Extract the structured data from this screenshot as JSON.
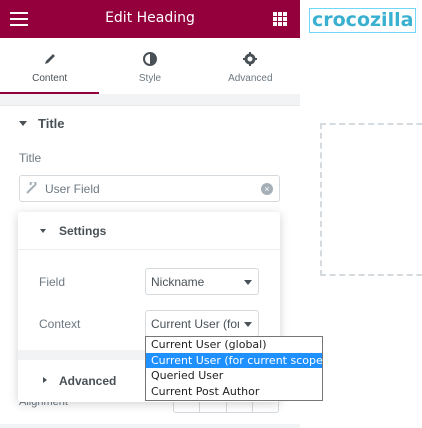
{
  "header": {
    "title": "Edit Heading"
  },
  "tabs": [
    {
      "label": "Content",
      "icon": "pencil-icon"
    },
    {
      "label": "Style",
      "icon": "contrast-icon"
    },
    {
      "label": "Advanced",
      "icon": "gear-icon"
    }
  ],
  "section": {
    "title": "Title"
  },
  "title_field": {
    "label": "Title",
    "value": "User Field"
  },
  "settings": {
    "title": "Settings",
    "field_label": "Field",
    "field_value": "Nickname",
    "context_label": "Context",
    "context_value": "Current User (for",
    "advanced_label": "Advanced"
  },
  "context_options": [
    "Current User (global)",
    "Current User (for current scope)",
    "Queried User",
    "Current Post Author"
  ],
  "behind": {
    "alignment_label": "Alignment"
  },
  "preview": {
    "logo_text": "crocozilla"
  },
  "colors": {
    "accent": "#93003c",
    "selection": "#1e90ff",
    "logo": "#3ab0d1"
  }
}
